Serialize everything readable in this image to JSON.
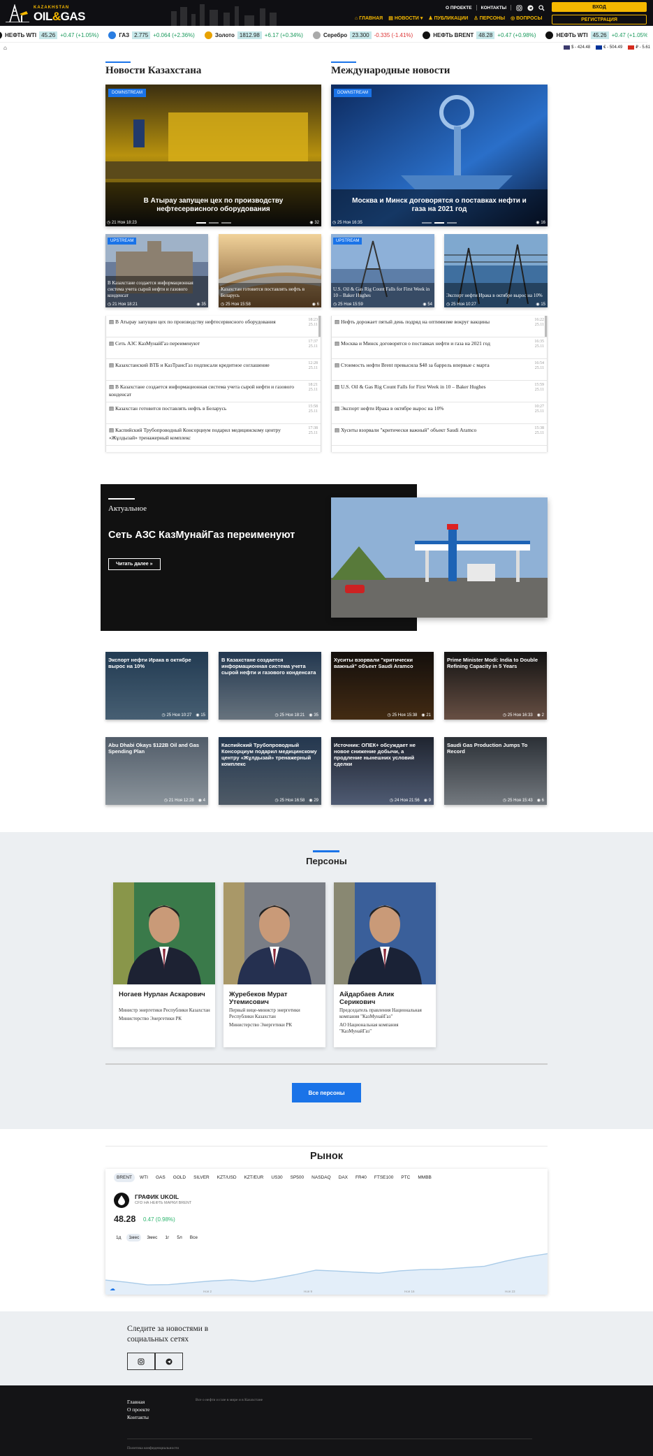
{
  "header": {
    "logo_top": "KAZAKHSTAN",
    "logo_main_1": "OIL",
    "logo_amp": "&",
    "logo_main_2": "GAS",
    "top_links": [
      "О ПРОЕКТЕ",
      "КОНТАКТЫ"
    ],
    "nav": [
      "ГЛАВНАЯ",
      "НОВОСТИ",
      "ПУБЛИКАЦИИ",
      "ПЕРСОНЫ",
      "ВОПРОСЫ"
    ],
    "login": "ВХОД",
    "register": "РЕГИСТРАЦИЯ"
  },
  "ticker": [
    {
      "name": "НЕФТЬ WTI",
      "value": "45.26",
      "change": "+0.47 (+1.05%)",
      "dir": "up",
      "color": "#111"
    },
    {
      "name": "ГАЗ",
      "value": "2.775",
      "change": "+0.064 (+2.36%)",
      "dir": "up",
      "color": "#2a7de1"
    },
    {
      "name": "Золото",
      "value": "1812.98",
      "change": "+6.17 (+0.34%)",
      "dir": "up",
      "color": "#e8a200"
    },
    {
      "name": "Серебро",
      "value": "23.300",
      "change": "-0.335 (-1.41%)",
      "dir": "dn",
      "color": "#aaa"
    },
    {
      "name": "НЕФТЬ BRENT",
      "value": "48.28",
      "change": "+0.47 (+0.98%)",
      "dir": "up",
      "color": "#111"
    },
    {
      "name": "НЕФТЬ WTI",
      "value": "45.26",
      "change": "+0.47 (+1.05%)",
      "dir": "up",
      "color": "#111"
    }
  ],
  "fx": [
    {
      "label": "$ - 424.48",
      "flag": "#3c3b6e"
    },
    {
      "label": "€ - 504.49",
      "flag": "#003399"
    },
    {
      "label": "₽ - 5.61",
      "flag": "#d52b1e"
    }
  ],
  "kz": {
    "title": "Новости Казахстана",
    "hero": {
      "badge": "DOWNSTREAM",
      "title": "В Атырау запущен цех по производству нефтесервисного оборудования",
      "date": "21 Ноя 18:23",
      "views": "32"
    },
    "cards": [
      {
        "badge": "UPSTREAM",
        "title": "В Казахстане создается информационная система учета сырой нефти и газового конденсат",
        "date": "21 Ноя 18:21",
        "views": "35"
      },
      {
        "badge": "",
        "title": "Казахстан готовится поставлять нефть в Беларусь",
        "date": "25 Ноя 15:58",
        "views": "6"
      }
    ],
    "list": [
      {
        "t": "В Атырау запущен цех по производству нефтесервисного оборудования",
        "time": "18:23",
        "date": "25.11"
      },
      {
        "t": "Сеть АЗС КазМунайГаз переименуют",
        "time": "17:37",
        "date": "25.11"
      },
      {
        "t": "Казахстанский ВТБ и КазТрансГаз подписали кредитное соглашение",
        "time": "12:28",
        "date": "25.11"
      },
      {
        "t": "В Казахстане создается информационная система учета сырой нефти и газового конденсат",
        "time": "18:21",
        "date": "25.11"
      },
      {
        "t": "Казахстан готовится поставлять нефть в Беларусь",
        "time": "15:58",
        "date": "25.11"
      },
      {
        "t": "Каспийский Трубопроводный Консорциум подарил медицинскому центру «Жұлдызай» тренажерный комплекс",
        "time": "17:38",
        "date": "25.11"
      }
    ]
  },
  "intl": {
    "title": "Международные новости",
    "hero": {
      "badge": "DOWNSTREAM",
      "title": "Москва и Минск договорятся о поставках нефти и газа на 2021 год",
      "date": "25 Ноя 16:35",
      "views": "16"
    },
    "cards": [
      {
        "badge": "UPSTREAM",
        "title": "U.S. Oil & Gas Rig Count Falls for First Week in 10 – Baker Hughes",
        "date": "25 Ноя 15:59",
        "views": "54"
      },
      {
        "badge": "",
        "title": "Экспорт нефти Ирака в октябре вырос на 10%",
        "date": "25 Ноя 10:27",
        "views": "15"
      }
    ],
    "list": [
      {
        "t": "Нефть дорожает пятый день подряд на оптимизме вокруг вакцины",
        "time": "16:22",
        "date": "25.11"
      },
      {
        "t": "Москва и Минск договорятся о поставках нефти и газа на 2021 год",
        "time": "16:35",
        "date": "25.11"
      },
      {
        "t": "Стоимость нефти Brent превысила $48 за баррель впервые с марта",
        "time": "16:54",
        "date": "25.11"
      },
      {
        "t": "U.S. Oil & Gas Rig Count Falls for First Week in 10 – Baker Hughes",
        "time": "15:59",
        "date": "25.11"
      },
      {
        "t": "Экспорт нефти Ирака в октябре вырос на 10%",
        "time": "10:27",
        "date": "25.11"
      },
      {
        "t": "Хуситы взорвали \"критически важный\" объект Saudi Aramco",
        "time": "15:38",
        "date": "25.11"
      }
    ]
  },
  "featured": {
    "kicker": "Актуальное",
    "title": "Сеть АЗС КазМунайГаз переименуют",
    "button": "Читать далее »"
  },
  "grid": [
    {
      "title": "Экспорт нефти Ирака в октябре вырос на 10%",
      "date": "25 Ноя 10:27",
      "views": "15"
    },
    {
      "title": "В Казахстане создается информационная система учета сырой нефти и газового конденсата",
      "date": "25 Ноя 18:21",
      "views": "35"
    },
    {
      "title": "Хуситы взорвали \"критически важный\" объект Saudi Aramco",
      "date": "25 Ноя 15:38",
      "views": "21"
    },
    {
      "title": "Prime Minister Modi: India to Double Refining Capacity in 5 Years",
      "date": "25 Ноя 16:33",
      "views": "2"
    },
    {
      "title": "Abu Dhabi Okays $122B Oil and Gas Spending Plan",
      "date": "21 Ноя 12:28",
      "views": "4"
    },
    {
      "title": "Каспийский Трубопроводный Консорциум подарил медицинскому центру «Жұлдызай» тренажерный комплекс",
      "date": "25 Ноя 16:58",
      "views": "29"
    },
    {
      "title": "Источник: ОПЕК+ обсуждает не новое снижение добычи, а продление нынешних условий сделки",
      "date": "24 Ноя 21:56",
      "views": "9"
    },
    {
      "title": "Saudi Gas Production Jumps To Record",
      "date": "25 Ноя 15:43",
      "views": "6"
    }
  ],
  "persons": {
    "title": "Персоны",
    "button": "Все персоны",
    "items": [
      {
        "name": "Ногаев Нурлан Аскарович",
        "pos": "Министр энергетики Республики Казахстан",
        "org": "Министерство Энергетики РК"
      },
      {
        "name": "Журебеков Мурат Утемисович",
        "pos": "Первый вице-министр энергетики Республики Казахстан",
        "org": "Министерство Энергетики РК"
      },
      {
        "name": "Айдарбаев Алик Серикович",
        "pos": "Председатель правления Национальная компания \"КазМунайГаз\"",
        "org": "АО Национальная компания \"КазМунайГаз\""
      }
    ]
  },
  "market": {
    "title": "Рынок",
    "tabs": [
      "BRENT",
      "WTI",
      "GAS",
      "GOLD",
      "SILVER",
      "KZT/USD",
      "KZT/EUR",
      "US30",
      "SP500",
      "NASDAQ",
      "DAX",
      "FR40",
      "FTSE100",
      "PTC",
      "MMBB"
    ],
    "name": "ГРАФИК UKOIL",
    "sub": "CFD НА НЕФТЬ МАРКИ BRENT",
    "price": "48.28",
    "change": "0.47 (0.98%)",
    "periods": [
      "1д",
      "1мес",
      "3мес",
      "1г",
      "5л",
      "Все"
    ]
  },
  "chart_data": {
    "type": "area",
    "title": "ГРАФИК UKOIL",
    "x": [
      "Ноя 2",
      "Ноя 9",
      "Ноя 16",
      "Ноя 23"
    ],
    "values": [
      39.5,
      38.8,
      37.9,
      38.0,
      38.6,
      39.2,
      39.6,
      39.1,
      40.0,
      41.3,
      42.8,
      42.5,
      42.1,
      41.8,
      42.6,
      43.0,
      43.1,
      43.6,
      44.1,
      45.8,
      47.2,
      48.28
    ],
    "ylim": [
      37,
      50
    ],
    "color": "#a9cbe8"
  },
  "social": {
    "title": "Следите за новостями в социальных сетях"
  },
  "footer": {
    "links": [
      "Главная",
      "О проекте",
      "Контакты"
    ],
    "tagline": "Все о нефти и газе в мире и в Казахстане",
    "privacy": "Политика конфиденциальности"
  }
}
